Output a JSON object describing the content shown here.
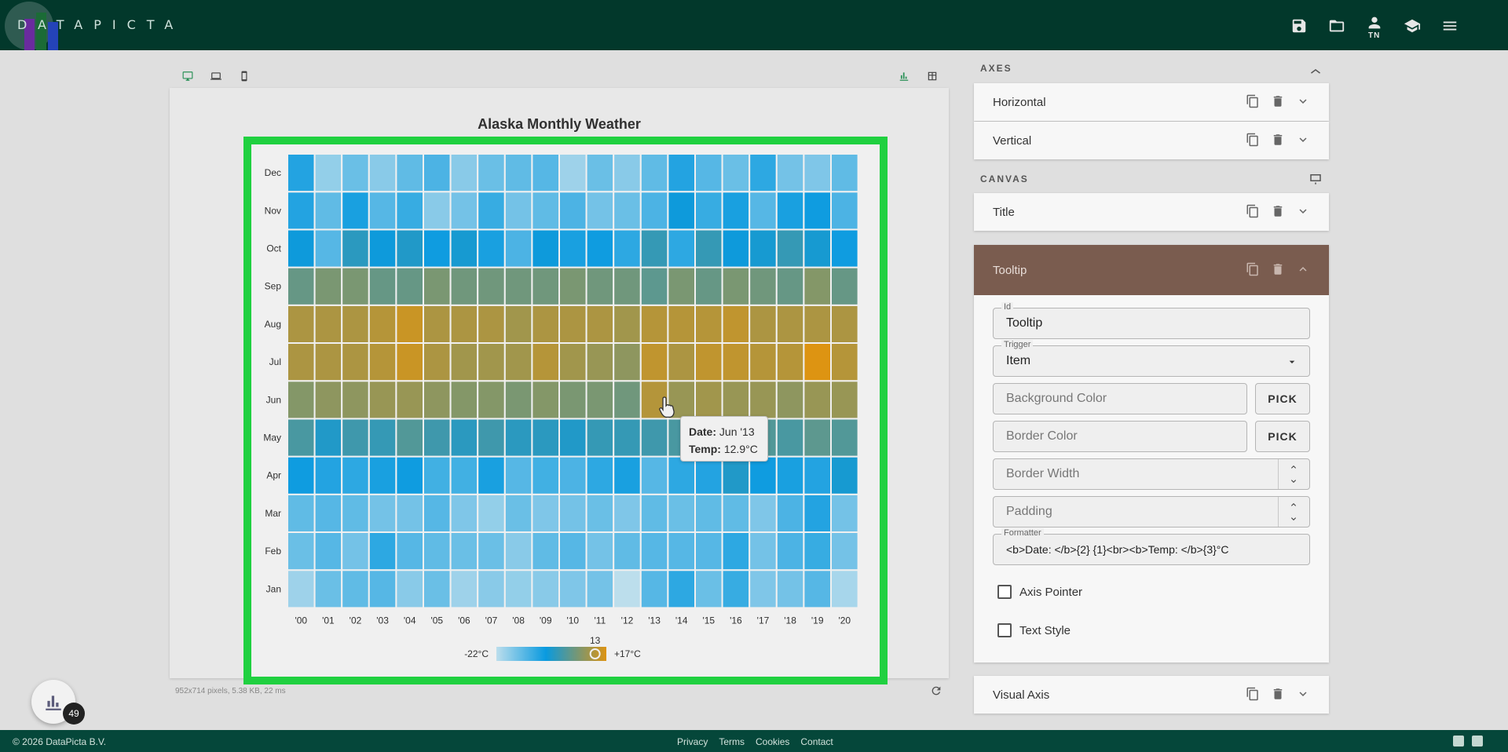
{
  "app": {
    "logo_text": "DATAPICTA"
  },
  "topbar": {
    "user_initials": "TN",
    "icons": [
      "save-icon",
      "folder-open-icon",
      "user-icon",
      "graduation-cap-icon",
      "menu-icon"
    ]
  },
  "devices": [
    "desktop-icon",
    "laptop-icon",
    "phone-icon"
  ],
  "status_line": "952x714 pixels, 5.38 KB, 22 ms",
  "chart_data": {
    "type": "heatmap",
    "title": "Alaska Monthly Weather",
    "x": [
      "'00",
      "'01",
      "'02",
      "'03",
      "'04",
      "'05",
      "'06",
      "'07",
      "'08",
      "'09",
      "'10",
      "'11",
      "'12",
      "'13",
      "'14",
      "'15",
      "'16",
      "'17",
      "'18",
      "'19",
      "'20"
    ],
    "y": [
      "Jan",
      "Feb",
      "Mar",
      "Apr",
      "May",
      "Jun",
      "Jul",
      "Aug",
      "Sep",
      "Oct",
      "Nov",
      "Dec"
    ],
    "values": [
      [
        -19,
        -14,
        -13,
        -12,
        -17,
        -14,
        -19,
        -17,
        -18,
        -17,
        -16,
        -15,
        -22,
        -12,
        -8,
        -14,
        -9,
        -16,
        -15,
        -12,
        -20
      ],
      [
        -14,
        -12,
        -15,
        -8,
        -12,
        -13,
        -14,
        -14,
        -17,
        -13,
        -12,
        -15,
        -13,
        -12,
        -12,
        -12,
        -8,
        -15,
        -11,
        -9,
        -15
      ],
      [
        -13,
        -12,
        -13,
        -15,
        -15,
        -12,
        -16,
        -18,
        -14,
        -16,
        -15,
        -14,
        -16,
        -13,
        -14,
        -13,
        -13,
        -16,
        -11,
        -7,
        -15
      ],
      [
        -5,
        -7,
        -8,
        -6,
        -5,
        -10,
        -10,
        -6,
        -12,
        -10,
        -11,
        -8,
        -6,
        -12,
        -8,
        -7,
        -2,
        -5,
        -6,
        -7,
        -3
      ],
      [
        2,
        -2,
        1,
        0,
        3,
        1,
        -1,
        1,
        -1,
        -1,
        -2,
        0,
        0,
        1,
        2,
        1,
        3,
        3,
        2,
        4,
        3
      ],
      [
        8,
        9,
        9,
        10,
        10,
        9,
        8,
        8,
        7,
        8,
        7,
        7,
        6,
        12.9,
        10,
        11,
        10,
        10,
        9,
        10,
        10
      ],
      [
        12,
        12,
        12,
        13,
        15,
        12,
        11,
        11,
        11,
        13,
        11,
        10,
        9,
        14,
        12,
        14,
        14,
        13,
        13,
        17,
        13
      ],
      [
        12,
        12,
        12,
        13,
        15,
        12,
        12,
        12,
        11,
        12,
        12,
        12,
        11,
        13,
        13,
        13,
        14,
        12,
        12,
        12,
        12
      ],
      [
        5,
        7,
        7,
        5,
        5,
        7,
        6,
        6,
        6,
        6,
        7,
        6,
        6,
        4,
        7,
        5,
        7,
        6,
        5,
        8,
        5
      ],
      [
        -4,
        -12,
        -1,
        -4,
        -2,
        -5,
        -3,
        -6,
        -11,
        -4,
        -6,
        -5,
        -8,
        0,
        -8,
        0,
        -4,
        -3,
        0,
        -3,
        -5
      ],
      [
        -7,
        -13,
        -6,
        -12,
        -9,
        -17,
        -15,
        -9,
        -15,
        -13,
        -11,
        -15,
        -14,
        -11,
        -4,
        -9,
        -6,
        -12,
        -6,
        -5,
        -11
      ],
      [
        -7,
        -18,
        -14,
        -17,
        -13,
        -11,
        -17,
        -14,
        -13,
        -12,
        -19,
        -14,
        -17,
        -13,
        -7,
        -12,
        -14,
        -8,
        -15,
        -16,
        -13
      ]
    ],
    "visual_map": {
      "min_label": "-22°C",
      "max_label": "+17°C",
      "min": -22,
      "max": 17,
      "handle_value": 13
    },
    "tooltip": {
      "date_label": "Date:",
      "date_value": "Jun '13",
      "temp_label": "Temp:",
      "temp_value": "12.9°C"
    }
  },
  "sidebar": {
    "axes_heading": "AXES",
    "canvas_heading": "CANVAS",
    "axes_panels": [
      "Horizontal",
      "Vertical"
    ],
    "canvas_panels": [
      "Title"
    ],
    "tooltip_panel": {
      "title": "Tooltip",
      "id_label": "Id",
      "id_value": "Tooltip",
      "trigger_label": "Trigger",
      "trigger_value": "Item",
      "bg_placeholder": "Background Color",
      "border_placeholder": "Border Color",
      "pick_label": "PICK",
      "border_width_placeholder": "Border Width",
      "padding_placeholder": "Padding",
      "formatter_label": "Formatter",
      "formatter_value": "<b>Date: </b>{2} {1}<br><b>Temp: </b>{3}°C",
      "axis_pointer_label": "Axis Pointer",
      "text_style_label": "Text Style"
    },
    "visual_axis_label": "Visual Axis"
  },
  "fab": {
    "badge": "49"
  },
  "footer": {
    "copyright": "© 2026 DataPicta B.V.",
    "links": [
      "Privacy",
      "Terms",
      "Cookies",
      "Contact"
    ]
  },
  "colors": {
    "topbar": "#02382b",
    "footer": "#05473a",
    "frame": "#22dd44",
    "tooltip_header": "#7a5c4f",
    "low": "#c8ecfb",
    "mid": "#0aa4ee",
    "high": "#eb9e14"
  }
}
